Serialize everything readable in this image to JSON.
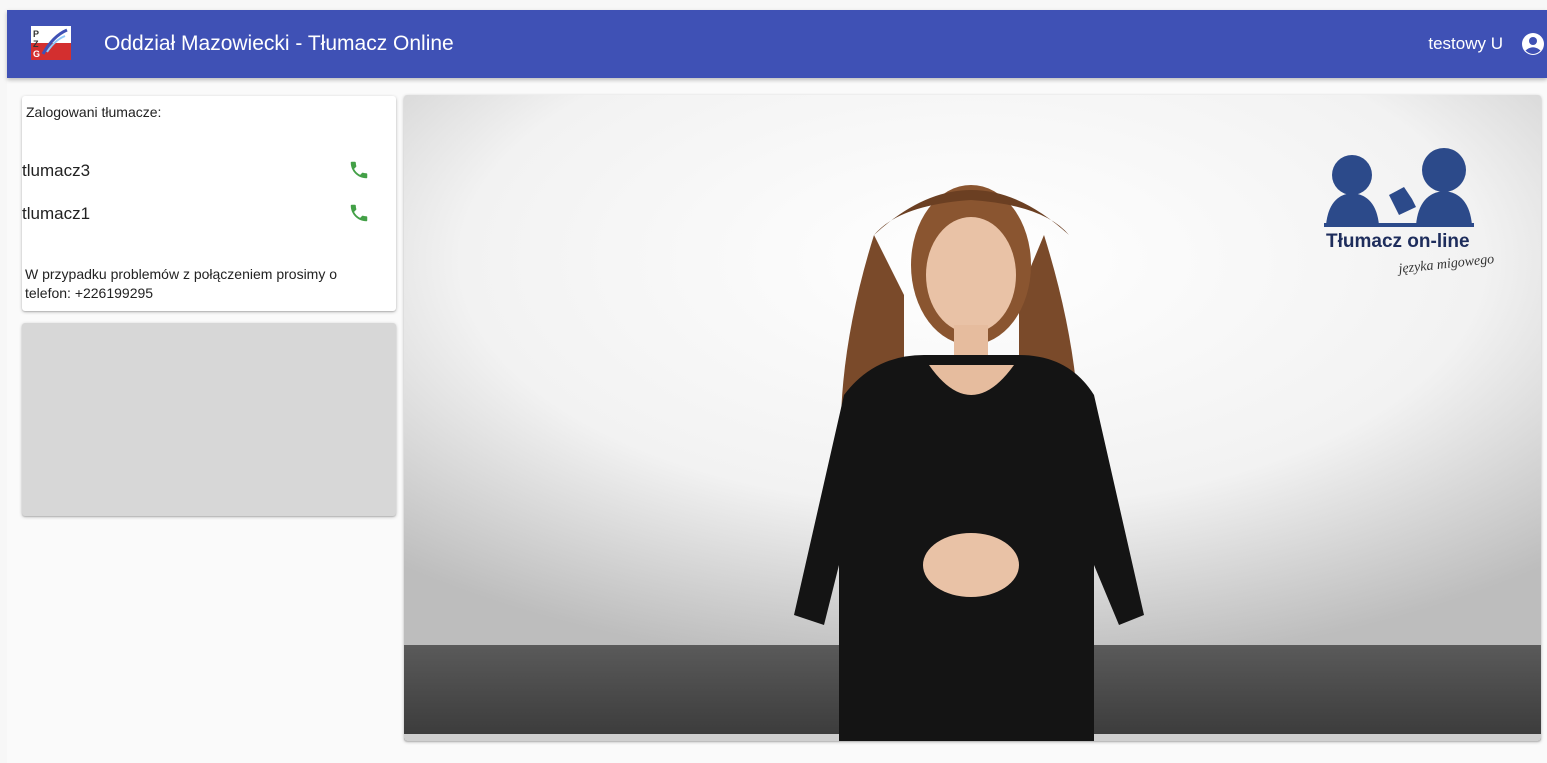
{
  "header": {
    "title": "Oddział Mazowiecki - Tłumacz Online",
    "user_name": "testowy U",
    "logo_icon": "pzg-logo-icon",
    "account_icon": "account-circle-icon",
    "background_color": "#3f51b5"
  },
  "interpreters": {
    "heading": "Zalogowani tłumacze:",
    "items": [
      {
        "name": "tlumacz3",
        "icon": "phone-icon"
      },
      {
        "name": "tlumacz1",
        "icon": "phone-icon"
      }
    ],
    "notice": "W przypadku problemów z połączeniem prosimy o telefon: +226199295",
    "phone_icon_color": "#43a047"
  },
  "video": {
    "brand_title": "Tłumacz on-line",
    "brand_subtitle": "języka migowego"
  }
}
